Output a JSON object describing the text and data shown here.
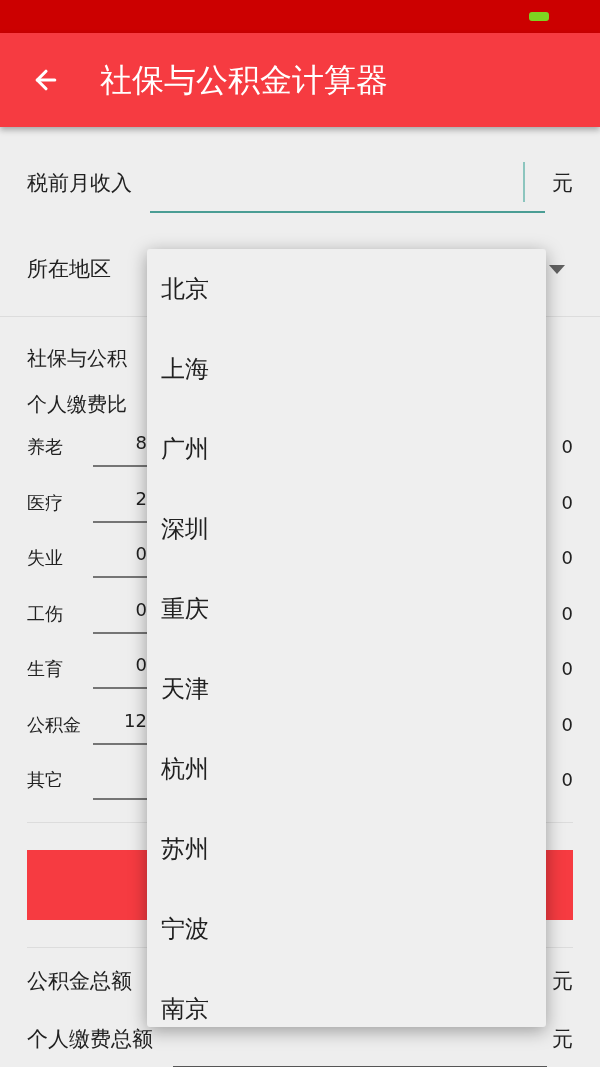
{
  "app_bar": {
    "title": "社保与公积金计算器"
  },
  "income": {
    "label": "税前月收入",
    "unit": "元",
    "focused": true
  },
  "region": {
    "label": "所在地区"
  },
  "rates": {
    "heading": "社保与公积",
    "subheading": "个人缴费比",
    "rows": [
      {
        "label": "养老",
        "rate": "8",
        "amount": "0"
      },
      {
        "label": "医疗",
        "rate": "2",
        "amount": "0"
      },
      {
        "label": "失业",
        "rate": "0",
        "amount": "0"
      },
      {
        "label": "工伤",
        "rate": "0",
        "amount": "0"
      },
      {
        "label": "生育",
        "rate": "0",
        "amount": "0"
      },
      {
        "label": "公积金",
        "rate": "12",
        "amount": "0"
      },
      {
        "label": "其它",
        "amount": "0"
      }
    ]
  },
  "results": [
    {
      "kind": "text",
      "label": "公积金总额",
      "unit": "元"
    },
    {
      "kind": "input",
      "label": "个人缴费总额",
      "unit": "元"
    }
  ],
  "dropdown": {
    "items": [
      {
        "label": "北京",
        "selected": false
      },
      {
        "label": "上海",
        "selected": false
      },
      {
        "label": "广州",
        "selected": false
      },
      {
        "label": "深圳",
        "selected": false
      },
      {
        "label": "重庆",
        "selected": false
      },
      {
        "label": "天津",
        "selected": false
      },
      {
        "label": "杭州",
        "selected": false
      },
      {
        "label": "苏州",
        "selected": false
      },
      {
        "label": "宁波",
        "selected": false
      },
      {
        "label": "南京",
        "selected": false
      }
    ]
  }
}
